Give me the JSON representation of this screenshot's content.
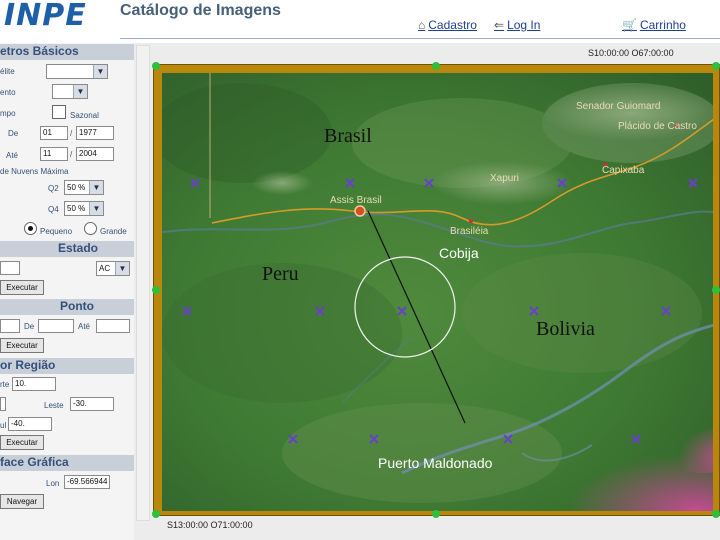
{
  "header": {
    "logo": "INPE",
    "title": "Catálogo de Imagens",
    "links": {
      "cadastro": "Cadastro",
      "login": "Log In",
      "carrinho": "Carrinho"
    }
  },
  "sidebar": {
    "basic_params_title": "etros Básicos",
    "satellite_label": "élite",
    "sensor_label": "ento",
    "time_label": "mpo",
    "seasonal_label": "Sazonal",
    "from_label": "De",
    "from_month": "01",
    "from_year": "1977",
    "to_label": "Até",
    "to_month": "11",
    "to_year": "2004",
    "clouds_label": "de Nuvens Máxima",
    "q2_label": "Q2",
    "q2_value": "50 %",
    "q4_label": "Q4",
    "q4_value": "50 %",
    "size_small_label": "Pequeno",
    "size_large_label": "Grande",
    "state_title": "Estado",
    "state_value": "AC",
    "execute_label": "Executar",
    "point_title": "Ponto",
    "point_from_label": "De",
    "point_to_label": "Até",
    "region_title": "or Região",
    "north_label": "rte",
    "north_value": "10.",
    "east_label": "Leste",
    "east_value": "-30.",
    "south_label": "ul",
    "south_value": "-40.",
    "graphic_title": "face Gráfica",
    "lon_label": "Lon",
    "lon_value": "-69.566944",
    "navigate_label": "Navegar"
  },
  "viewer": {
    "coord_top": "S10:00:00 O67:00:00",
    "coord_bottom": "S13:00:00 O71:00:00"
  },
  "map": {
    "labels": {
      "brasil": "Brasil",
      "peru": "Peru",
      "bolivia": "Bolivia",
      "cobija": "Cobija",
      "puerto": "Puerto Maldonado",
      "assis": "Assis Brasil",
      "brasileia": "Brasiléia",
      "senador": "Senador Guiomard",
      "placido": "Plácido de Castro",
      "xapuri": "Xapuri",
      "capixaba": "Capixaba"
    },
    "colors": {
      "frame": "#b8870c",
      "marker": "#6a3fd0",
      "handle": "#2fbf3d",
      "road": "#d69a2a"
    }
  }
}
